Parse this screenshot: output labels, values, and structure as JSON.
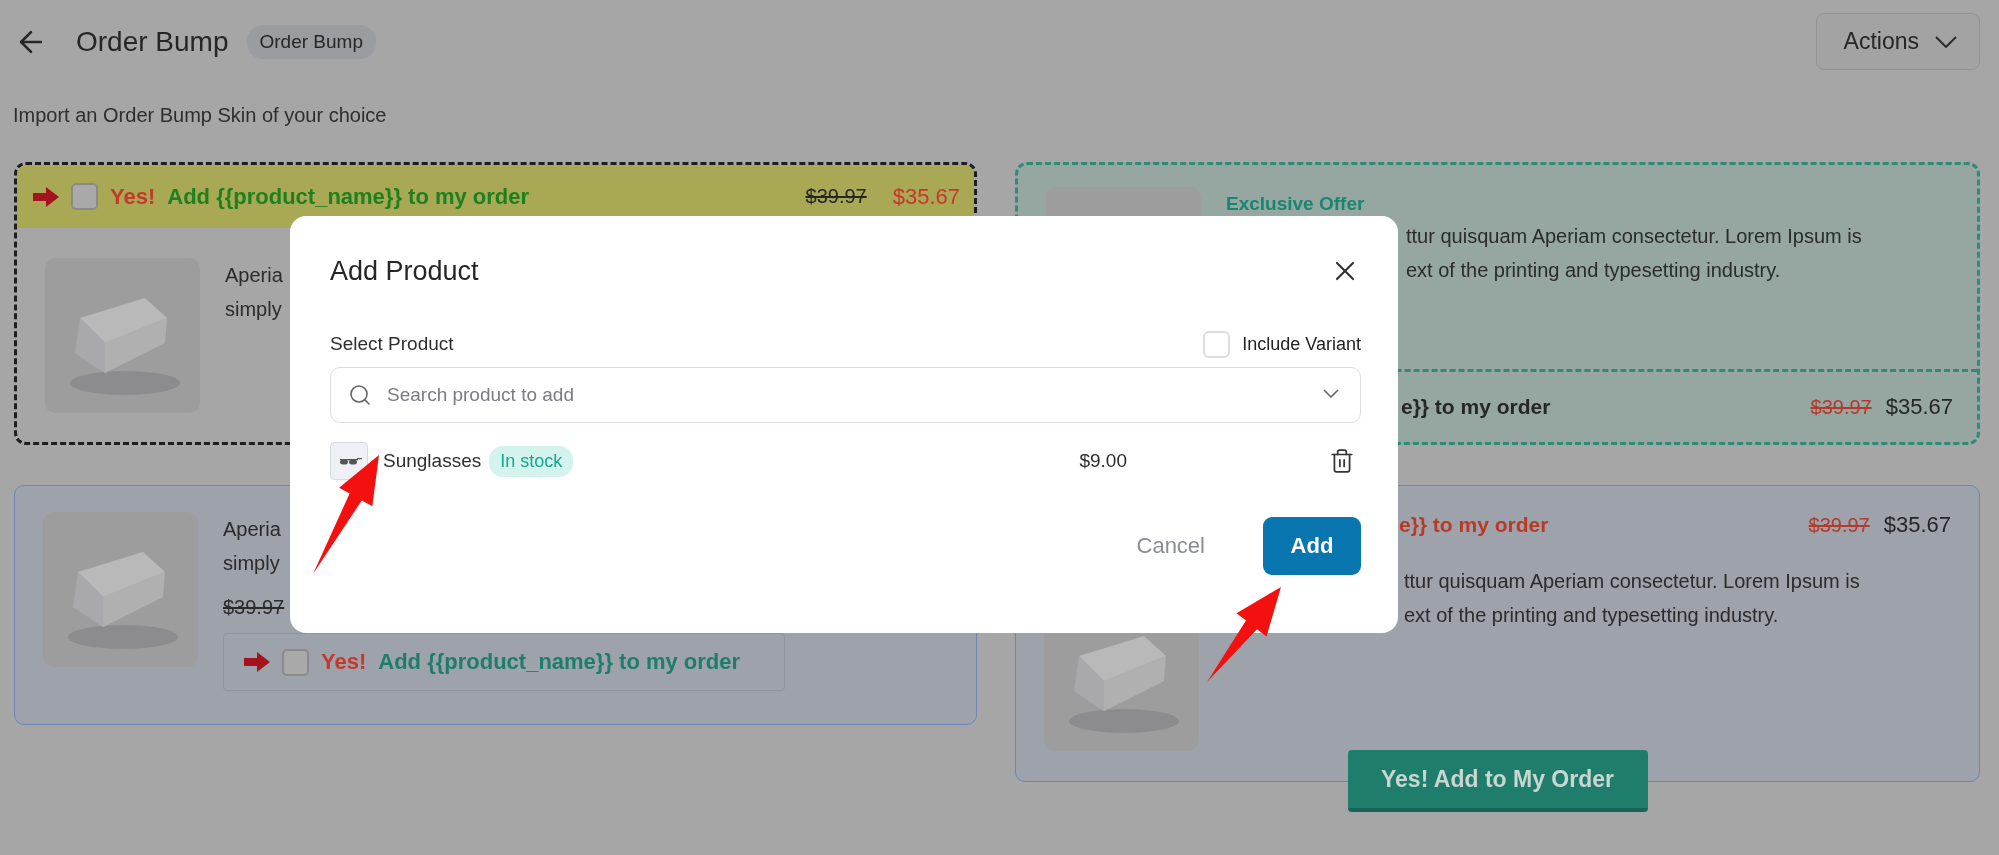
{
  "header": {
    "title": "Order Bump",
    "badge": "Order Bump",
    "actions": "Actions"
  },
  "subtitle": "Import an Order Bump Skin of your choice",
  "skins": [
    {
      "kind": "top_bar",
      "checked": false,
      "prefix": "Yes!",
      "text": "Add {{product_name}} to my order",
      "old_price": "$39.97",
      "price": "$35.67",
      "lines": [
        "Aperia",
        "simply"
      ]
    },
    {
      "kind": "offer",
      "label": "Exclusive Offer",
      "lines": [
        "ttur quisquam Aperiam consectetur. Lorem Ipsum is",
        "ext of the printing and typesetting industry."
      ],
      "text": "e}} to my order",
      "old_price": "$39.97",
      "price": "$35.67"
    },
    {
      "kind": "inline",
      "checked": false,
      "lines": [
        "Aperia",
        "simply"
      ],
      "old_price": "$39.97",
      "prefix": "Yes!",
      "text": "Add {{product_name}} to my order"
    },
    {
      "kind": "button",
      "text": "e}} to my order",
      "old_price": "$39.97",
      "price": "$35.67",
      "lines": [
        "ttur quisquam Aperiam consectetur. Lorem Ipsum is",
        "ext of the printing and typesetting industry."
      ],
      "button": "Yes! Add to My Order"
    }
  ],
  "modal": {
    "title": "Add Product",
    "select_label": "Select Product",
    "include_variant": {
      "label": "Include Variant",
      "checked": false
    },
    "search": {
      "placeholder": "Search product to add"
    },
    "products": [
      {
        "name": "Sunglasses",
        "stock": "In stock",
        "price": "$9.00"
      }
    ],
    "cancel": "Cancel",
    "add": "Add"
  }
}
